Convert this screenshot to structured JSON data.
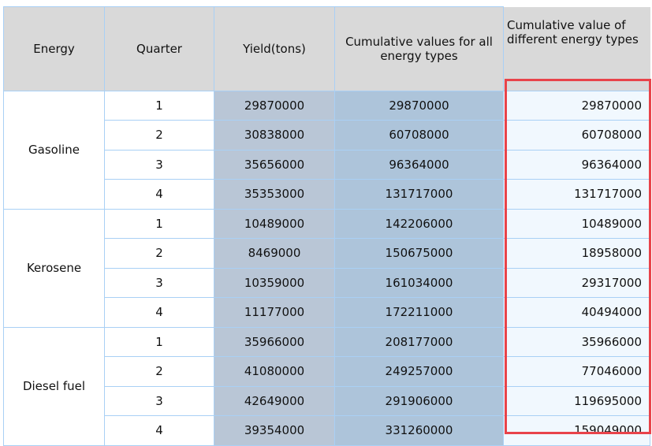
{
  "headers": [
    "Energy",
    "Quarter",
    "Yield(tons)",
    "Cumulative values for all energy types",
    "Cumulative value of different energy types"
  ],
  "groups": [
    {
      "energy": "Gasoline",
      "rows": [
        {
          "q": "1",
          "yield": "29870000",
          "cum_all": "29870000",
          "cum_type": "29870000"
        },
        {
          "q": "2",
          "yield": "30838000",
          "cum_all": "60708000",
          "cum_type": "60708000"
        },
        {
          "q": "3",
          "yield": "35656000",
          "cum_all": "96364000",
          "cum_type": "96364000"
        },
        {
          "q": "4",
          "yield": "35353000",
          "cum_all": "131717000",
          "cum_type": "131717000"
        }
      ]
    },
    {
      "energy": "Kerosene",
      "rows": [
        {
          "q": "1",
          "yield": "10489000",
          "cum_all": "142206000",
          "cum_type": "10489000"
        },
        {
          "q": "2",
          "yield": "8469000",
          "cum_all": "150675000",
          "cum_type": "18958000"
        },
        {
          "q": "3",
          "yield": "10359000",
          "cum_all": "161034000",
          "cum_type": "29317000"
        },
        {
          "q": "4",
          "yield": "11177000",
          "cum_all": "172211000",
          "cum_type": "40494000"
        }
      ]
    },
    {
      "energy": "Diesel fuel",
      "rows": [
        {
          "q": "1",
          "yield": "35966000",
          "cum_all": "208177000",
          "cum_type": "35966000"
        },
        {
          "q": "2",
          "yield": "41080000",
          "cum_all": "249257000",
          "cum_type": "77046000"
        },
        {
          "q": "3",
          "yield": "42649000",
          "cum_all": "291906000",
          "cum_type": "119695000"
        },
        {
          "q": "4",
          "yield": "39354000",
          "cum_all": "331260000",
          "cum_type": "159049000"
        }
      ]
    }
  ],
  "colors": {
    "highlight": "#e8434a",
    "yield_bg": "#b9c6d6",
    "cum_bg": "#adc4da"
  }
}
